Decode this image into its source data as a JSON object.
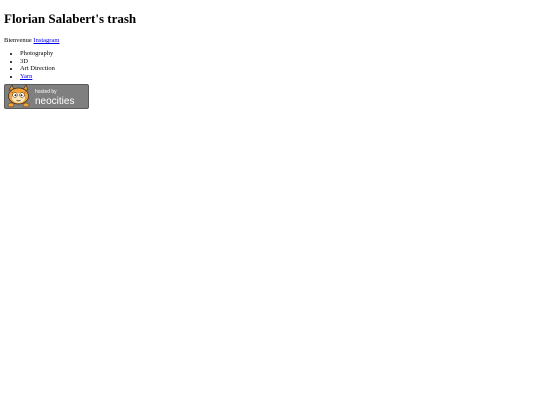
{
  "page": {
    "title": "Florian Salabert's trash",
    "intro_text": "Bienvenue",
    "intro_link": "Instagram",
    "menu_items": [
      {
        "label": "Photography",
        "is_link": false
      },
      {
        "label": "3D",
        "is_link": false
      },
      {
        "label": "Art Direction",
        "is_link": false
      },
      {
        "label": "Yarn",
        "is_link": true
      }
    ]
  },
  "badge": {
    "icon": "neocities-cat-logo",
    "line1": "hosted by",
    "line2": "neocities"
  },
  "colors": {
    "link": "#0000ee",
    "badge_bg": "#7f7f7f",
    "badge_text": "#ffffff"
  }
}
